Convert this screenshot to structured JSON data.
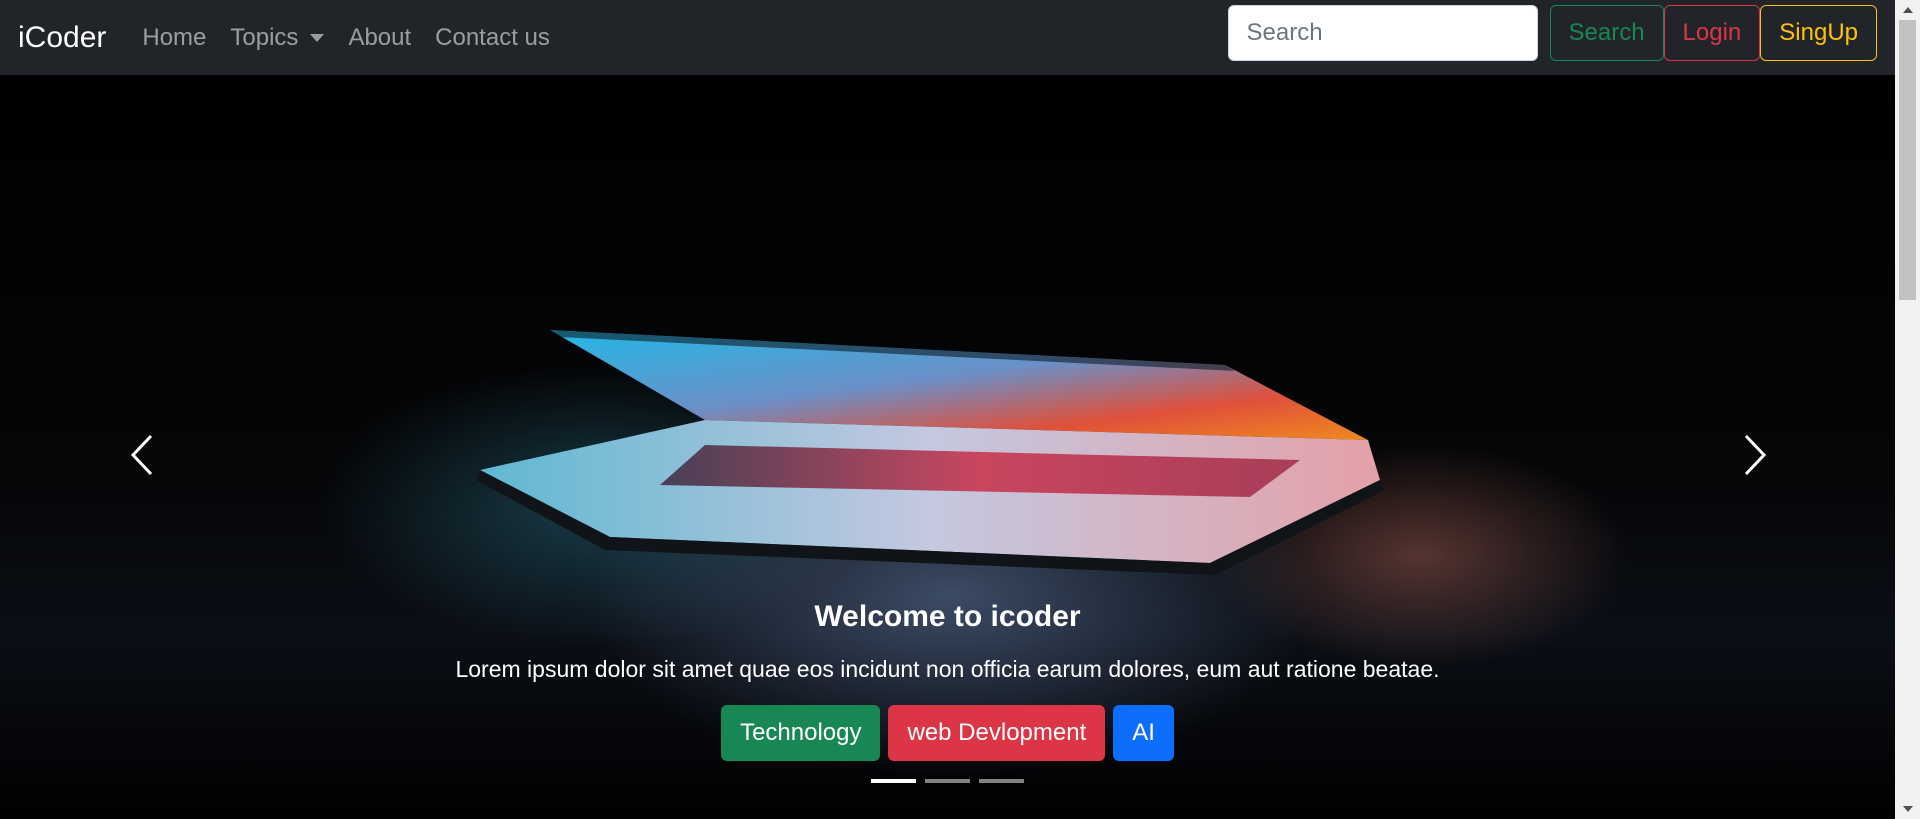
{
  "navbar": {
    "brand": "iCoder",
    "links": [
      "Home",
      "Topics",
      "About",
      "Contact us"
    ],
    "search_placeholder": "Search",
    "search_button": "Search",
    "login_button": "Login",
    "signup_button": "SingUp"
  },
  "carousel": {
    "title": "Welcome to icoder",
    "text": "Lorem ipsum dolor sit amet quae eos incidunt non officia earum dolores, eum aut ratione beatae.",
    "buttons": [
      "Technology",
      "web Devlopment",
      "AI"
    ],
    "active_slide": 1,
    "slide_count": 3
  },
  "colors": {
    "navbar_bg": "#212529",
    "success": "#198754",
    "danger": "#dc3545",
    "warning": "#ffc107",
    "primary": "#0d6efd"
  }
}
